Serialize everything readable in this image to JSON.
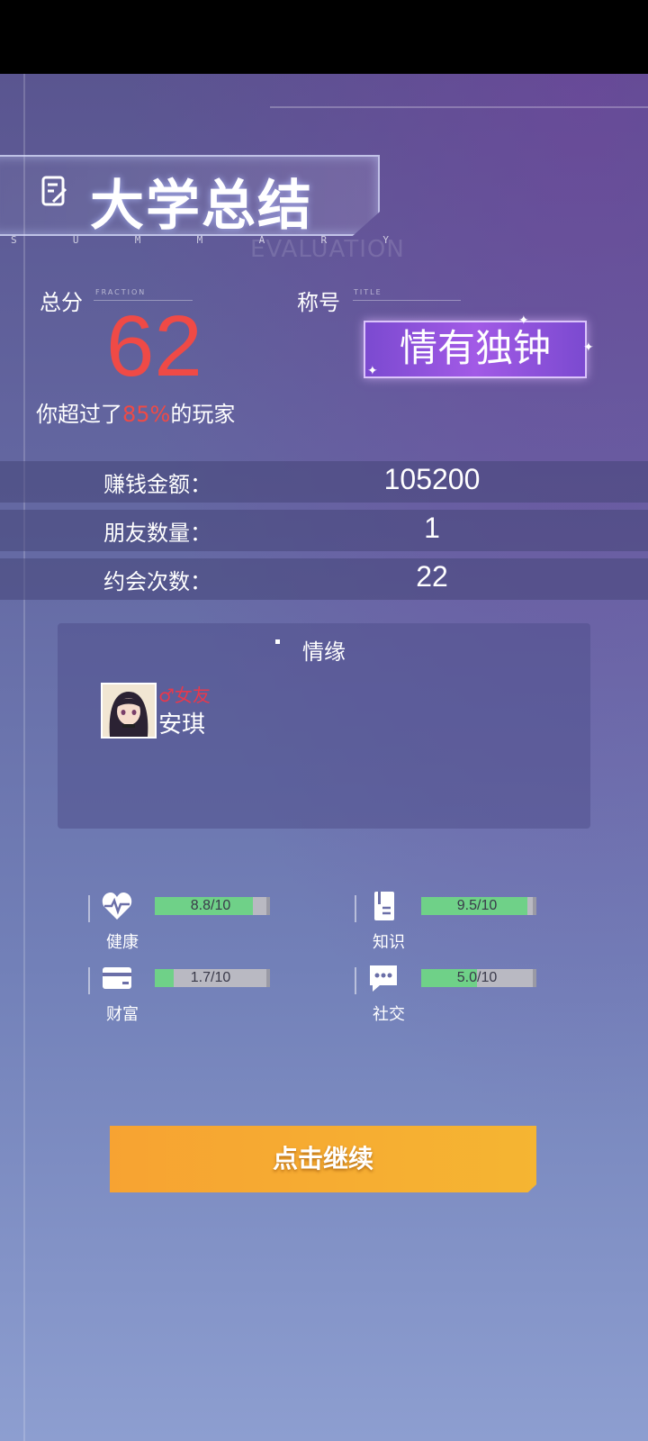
{
  "header": {
    "title": "大学总结",
    "subtitle_letters": [
      "S",
      "U",
      "M",
      "M",
      "A",
      "R",
      "Y"
    ],
    "watermark": "EVALUATION"
  },
  "score": {
    "label": "总分",
    "label_en": "FRACTION",
    "value": "62",
    "surpass_prefix": "你超过了",
    "surpass_percent": "85%",
    "surpass_suffix": "的玩家",
    "color": "#ef4a46"
  },
  "title_award": {
    "label": "称号",
    "label_en": "TITLE",
    "value": "情有独钟"
  },
  "stats": [
    {
      "label": "赚钱金额：",
      "value": "105200"
    },
    {
      "label": "朋友数量：",
      "value": "1"
    },
    {
      "label": "约会次数：",
      "value": "22"
    }
  ],
  "relationship": {
    "title": "情缘",
    "partner_role": "♂女友",
    "partner_name": "安琪"
  },
  "attributes": [
    {
      "name": "健康",
      "value": "8.8/10",
      "level": 0.88,
      "icon": "heart-icon"
    },
    {
      "name": "知识",
      "value": "9.5/10",
      "level": 0.95,
      "icon": "book-icon"
    },
    {
      "name": "财富",
      "value": "1.7/10",
      "level": 0.17,
      "icon": "wallet-icon"
    },
    {
      "name": "社交",
      "value": "5.0/10",
      "level": 0.5,
      "icon": "chat-icon"
    }
  ],
  "continue_button": "点击继续"
}
